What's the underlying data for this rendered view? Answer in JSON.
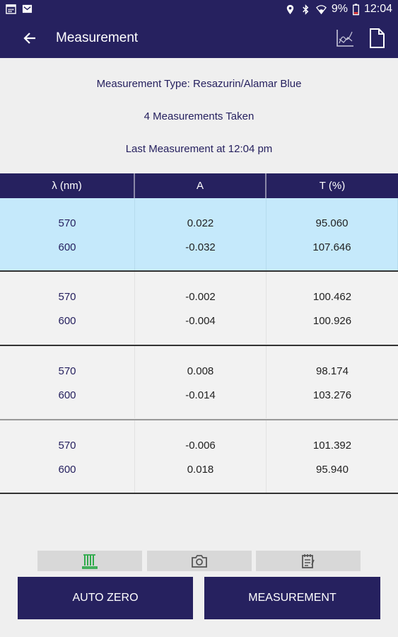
{
  "status_bar": {
    "battery": "9%",
    "time": "12:04"
  },
  "appbar": {
    "title": "Measurement"
  },
  "info": {
    "type_line": "Measurement Type: Resazurin/Alamar Blue",
    "count_line": "4 Measurements Taken",
    "last_line": "Last Measurement at 12:04 pm"
  },
  "table": {
    "headers": [
      "λ (nm)",
      "A",
      "T (%)"
    ],
    "rows": [
      {
        "selected": true,
        "lines": [
          [
            "570",
            "0.022",
            "95.060"
          ],
          [
            "600",
            "-0.032",
            "107.646"
          ]
        ]
      },
      {
        "selected": false,
        "lines": [
          [
            "570",
            "-0.002",
            "100.462"
          ],
          [
            "600",
            "-0.004",
            "100.926"
          ]
        ]
      },
      {
        "selected": false,
        "lines": [
          [
            "570",
            "0.008",
            "98.174"
          ],
          [
            "600",
            "-0.014",
            "103.276"
          ]
        ]
      },
      {
        "selected": false,
        "lines": [
          [
            "570",
            "-0.006",
            "101.392"
          ],
          [
            "600",
            "0.018",
            "95.940"
          ]
        ]
      }
    ]
  },
  "tools": [
    {
      "icon": "test-tubes-icon"
    },
    {
      "icon": "camera-icon"
    },
    {
      "icon": "notepad-icon"
    }
  ],
  "buttons": {
    "auto_zero": "AUTO ZERO",
    "measurement": "MEASUREMENT"
  },
  "colors": {
    "primary": "#26215f",
    "selected_row": "#c5e9fb",
    "accent_green": "#2eaa4a"
  }
}
